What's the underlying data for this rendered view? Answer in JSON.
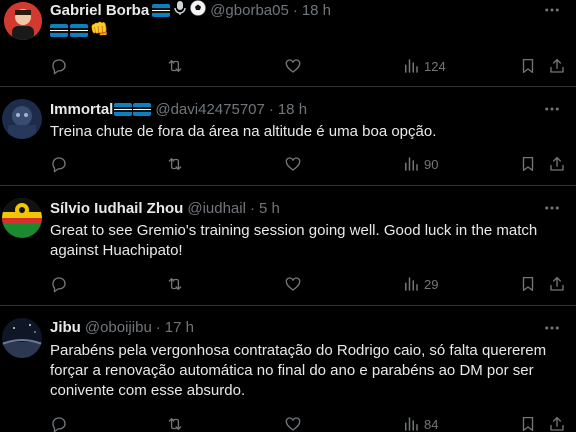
{
  "tweets": [
    {
      "name": "Gabriel Borba",
      "handle": "@gborba05",
      "time": "18 h",
      "text": "",
      "views": "124",
      "avatar_colors": [
        "#c9302c",
        "#f1f1f1"
      ]
    },
    {
      "name": "Immortal",
      "handle": "@davi42475707",
      "time": "18 h",
      "text": "Treina chute de fora da área na altitude é uma boa opção.",
      "views": "90",
      "avatar_colors": [
        "#1c2c4a",
        "#56647a"
      ]
    },
    {
      "name": "Sílvio Iudhail Zhou",
      "handle": "@iudhail",
      "time": "5 h",
      "text": "Great to see Gremio's training session going well. Good luck in the match against Huachipato!",
      "views": "29",
      "avatar_colors": [
        "#f2c500",
        "#1b8a2e"
      ]
    },
    {
      "name": "Jibu",
      "handle": "@oboijibu",
      "time": "17 h",
      "text": "Parabéns pela vergonhosa contratação do Rodrigo caio, só falta quererem forçar a renovação automática no final do ano e parabéns ao DM por ser conivente com esse absurdo.",
      "views": "84",
      "avatar_colors": [
        "#1a2233",
        "#4a5872"
      ]
    }
  ],
  "icons": {
    "reply": "reply-icon",
    "retweet": "retweet-icon",
    "like": "heart-icon",
    "views": "views-icon",
    "bookmark": "bookmark-icon",
    "share": "share-icon",
    "more": "more-icon"
  },
  "colors": {
    "background": "#000000",
    "text": "#e7e9ea",
    "muted": "#71767b",
    "divider": "#2f3336"
  }
}
